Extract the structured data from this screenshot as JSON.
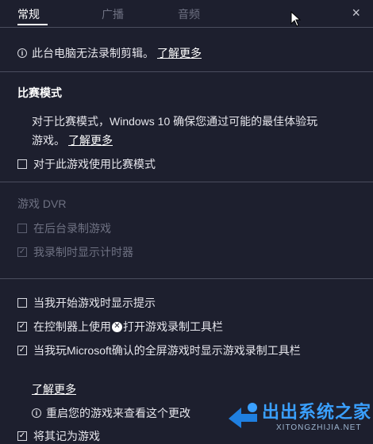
{
  "tabs": [
    {
      "label": "常规"
    },
    {
      "label": "广播"
    },
    {
      "label": "音频"
    }
  ],
  "close_label": "×",
  "notice": {
    "text": "此台电脑无法录制剪辑。",
    "link": "了解更多"
  },
  "game_mode": {
    "title": "比赛模式",
    "desc_line1": "对于比赛模式，Windows 10 确保您通过可能的最佳体验玩",
    "desc_line2": "游戏。",
    "link": "了解更多",
    "checkbox_label": "对于此游戏使用比赛模式"
  },
  "dvr": {
    "title": "游戏 DVR",
    "record_background": "在后台录制游戏",
    "show_timer": "我录制时显示计时器"
  },
  "options": {
    "show_tips": "当我开始游戏时显示提示",
    "open_with_controller_prefix": "在控制器上使用",
    "open_with_controller_suffix": "打开游戏录制工具栏",
    "fullscreen_toolbar": "当我玩Microsoft确认的全屏游戏时显示游戏录制工具栏"
  },
  "more": {
    "link": "了解更多",
    "restart_notice": "重启您的游戏来查看这个更改",
    "remember_as_game": "将其记为游戏"
  },
  "watermark": {
    "text": "出出系统之家",
    "sub": "XITONGZHIJIA.NET"
  },
  "colors": {
    "background": "#1d1f2e",
    "accent": "#3aa0ff"
  }
}
